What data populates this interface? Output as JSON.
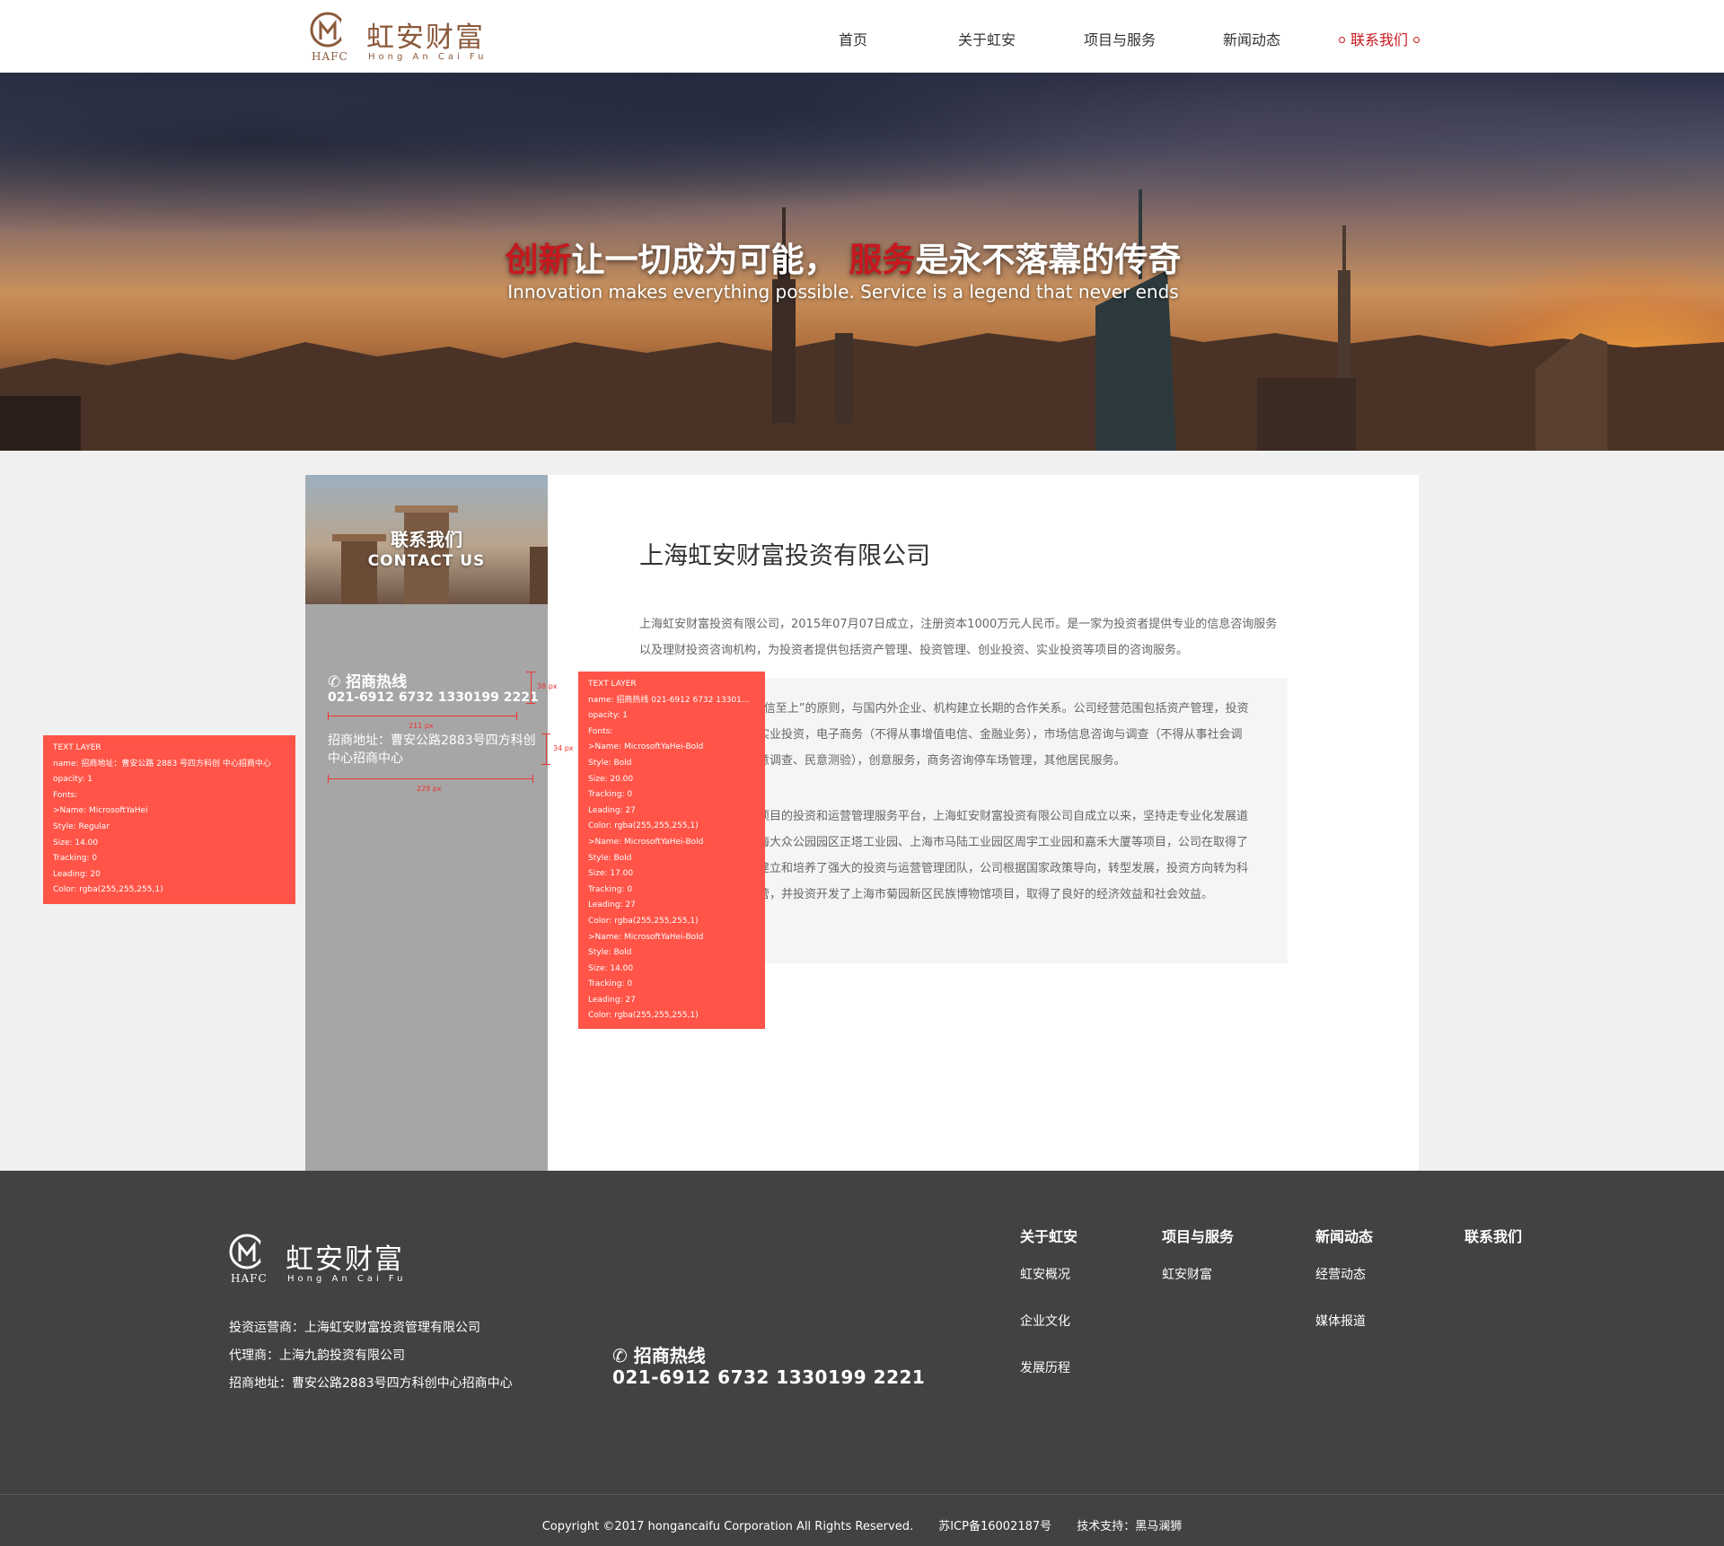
{
  "brand": {
    "name_cn": "虹安财富",
    "abbr": "HAFC",
    "name_en": "Hong An Cai Fu",
    "color": "#8b5a3c"
  },
  "nav": {
    "items": [
      "首页",
      "关于虹安",
      "项目与服务",
      "新闻动态",
      "联系我们"
    ],
    "active_index": 4,
    "active_color": "#c8171e"
  },
  "banner": {
    "cn_part1": "创新",
    "cn_part2": "让一切成为可能，",
    "cn_part3": "服务",
    "cn_part4": "是永不落幕的传奇",
    "en": "Innovation makes everything possible. Service is a legend that never ends"
  },
  "sidebar": {
    "title_cn": "联系我们",
    "title_en": "CONTACT US",
    "hotline_label": "招商热线",
    "hotline_numbers": "021-6912 6732  1330199 2221",
    "address": "招商地址：曹安公路2883号四方科创中心招商中心"
  },
  "content": {
    "title": "上海虹安财富投资有限公司",
    "intro": "上海虹安财富投资有限公司，2015年07月07日成立，注册资本1000万元人民币。是一家为投资者提供专业的信息咨询服务以及理财投资咨询机构，为投资者提供包括资产管理、投资管理、创业投资、实业投资等项目的咨询服务。",
    "paragraph1": "本着“客户第一，诚信至上”的原则，与国内外企业、机构建立长期的合作关系。公司经营范围包括资产管理，投资管理，创业投资，实业投资，电子商务（不得从事增值电信、金融业务），市场信息咨询与调查（不得从事社会调查、社会调研、民意调查、民意测验），创意服务，商务咨询停车场管理，其他居民服务。",
    "paragraph2": "作为四方科创中心项目的投资和运营管理服务平台，上海虹安财富投资有限公司自成立以来，坚持走专业化发展道路，先后开发了上海大众公园园区正塔工业园、上海市马陆工业园区周宇工业园和嘉禾大厦等项目，公司在取得了较大发展的同时，建立和培养了强大的投资与运营管理团队，公司根据国家政策导向，转型发展，投资方向转为科创园区的开发与经营，并投资开发了上海市菊园新区民族博物馆项目，取得了良好的经济效益和社会效益。"
  },
  "spec_left": {
    "lines": [
      "TEXT LAYER",
      "name: 招商地址：曹安公路 2883 号四方科创 中心招商中心",
      "opacity: 1",
      "Fonts:",
      ">Name: MicrosoftYaHei",
      "Style: Regular",
      "Size: 14.00",
      "Tracking: 0",
      "Leading: 20",
      "Color: rgba(255,255,255,1)"
    ]
  },
  "spec_right": {
    "lines": [
      "TEXT LAYER",
      "name:     招商热线 021-6912 6732  13301...",
      "opacity: 1",
      "Fonts:",
      ">Name: MicrosoftYaHei-Bold",
      "Style: Bold",
      "Size: 20.00",
      "Tracking: 0",
      "Leading: 27",
      "Color: rgba(255,255,255,1)",
      ">Name: MicrosoftYaHei-Bold",
      "Style: Bold",
      "Size: 17.00",
      "Tracking: 0",
      "Leading: 27",
      "Color: rgba(255,255,255,1)",
      ">Name: MicrosoftYaHei-Bold",
      "Style: Bold",
      "Size: 14.00",
      "Tracking: 0",
      "Leading: 27",
      "Color: rgba(255,255,255,1)"
    ]
  },
  "spec_measures": {
    "height_hotline": "38 px",
    "width_hotline": "211 px",
    "height_address": "34 px",
    "width_address": "229 px"
  },
  "footer": {
    "operator": "投资运营商：上海虹安财富投资管理有限公司",
    "agent": "代理商：上海九韵投资有限公司",
    "address": "招商地址：曹安公路2883号四方科创中心招商中心",
    "hotline_label": "招商热线",
    "hotline_numbers": "021-6912 6732  1330199 2221",
    "columns": [
      {
        "title": "关于虹安",
        "links": [
          "虹安概况",
          "企业文化",
          "发展历程"
        ]
      },
      {
        "title": "项目与服务",
        "links": [
          "虹安财富"
        ]
      },
      {
        "title": "新闻动态",
        "links": [
          "经营动态",
          "媒体报道"
        ]
      },
      {
        "title": "联系我们",
        "links": []
      }
    ],
    "copyright": "Copyright ©2017 hongancaifu Corporation All Rights Reserved.",
    "icp": "苏ICP备16002187号",
    "support": "技术支持：黑马澜狮"
  }
}
